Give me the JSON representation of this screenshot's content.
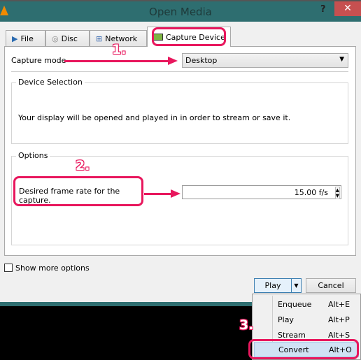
{
  "window": {
    "title": "Open Media",
    "help": "?",
    "close": "✕"
  },
  "tabs": [
    {
      "label": "File",
      "icon": "file-play-icon"
    },
    {
      "label": "Disc",
      "icon": "disc-icon"
    },
    {
      "label": "Network",
      "icon": "network-icon"
    },
    {
      "label": "Capture Device",
      "icon": "capture-card-icon",
      "active": true
    }
  ],
  "capture": {
    "mode_label": "Capture mode",
    "mode_value": "Desktop"
  },
  "device_selection": {
    "title": "Device Selection",
    "message": "Your display will be opened and played in in order to stream or save it."
  },
  "options": {
    "title": "Options",
    "frame_rate_label": "Desired frame rate for the capture.",
    "frame_rate_value": "15.00 f/s"
  },
  "show_more": {
    "label": "Show more options",
    "checked": false
  },
  "buttons": {
    "play": "Play",
    "cancel": "Cancel"
  },
  "menu": [
    {
      "label": "Enqueue",
      "shortcut": "Alt+E"
    },
    {
      "label": "Play",
      "shortcut": "Alt+P"
    },
    {
      "label": "Stream",
      "shortcut": "Alt+S"
    },
    {
      "label": "Convert",
      "shortcut": "Alt+O",
      "highlighted": true
    }
  ],
  "annotations": [
    "1.",
    "2.",
    "3."
  ],
  "colors": {
    "titlebar": "#2e6e70",
    "highlight": "#e8175d",
    "close": "#c75050"
  }
}
